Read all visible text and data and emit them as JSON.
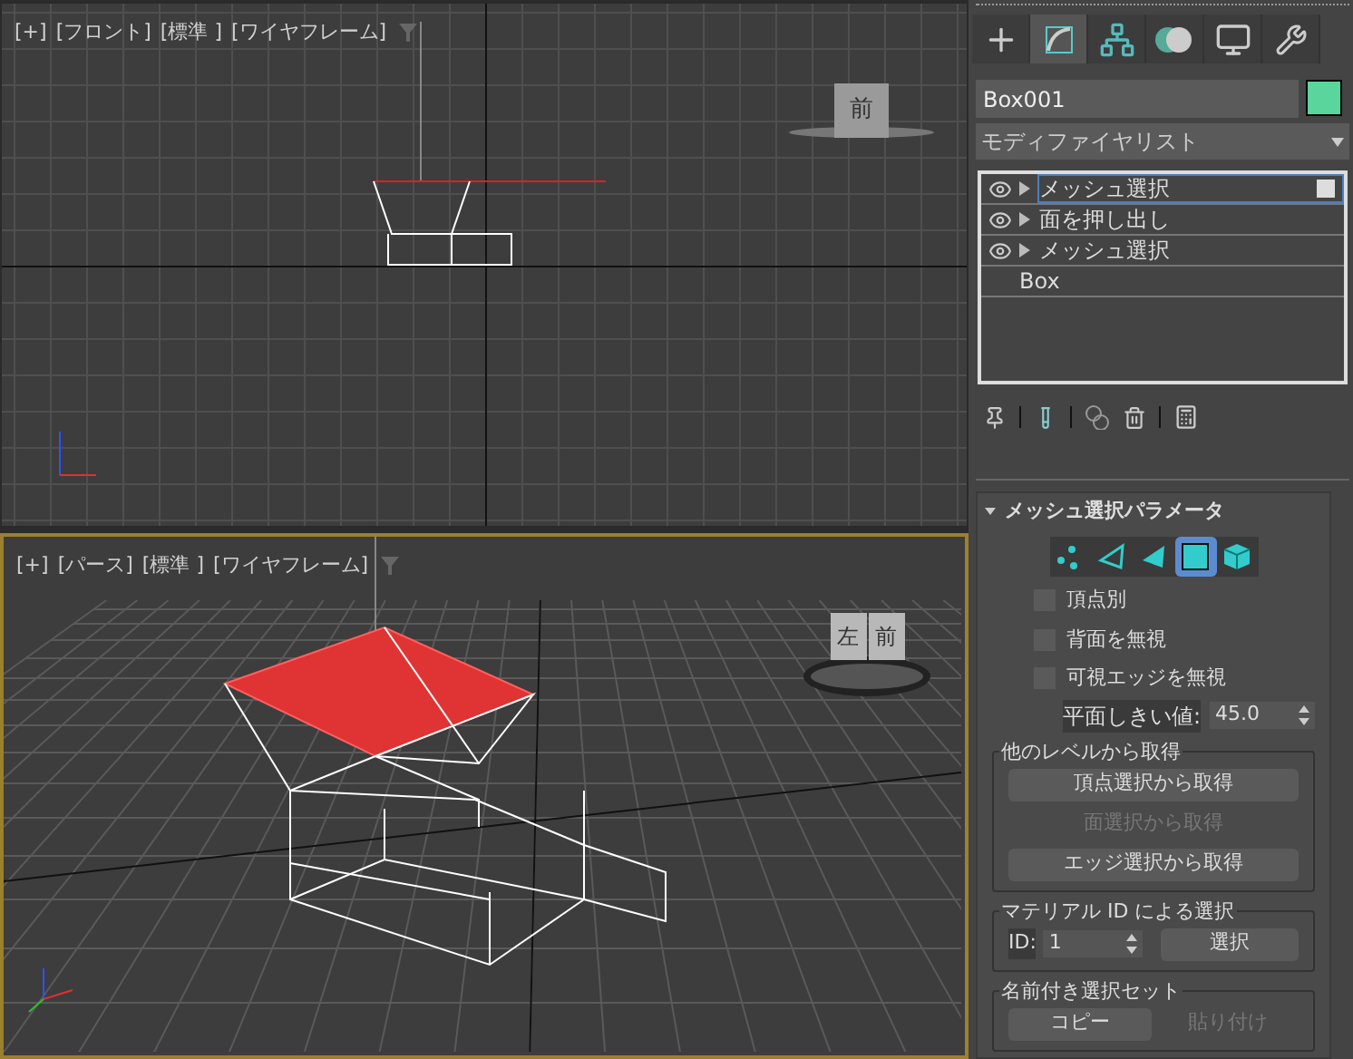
{
  "viewports": [
    {
      "kind": "front",
      "active": false,
      "labels": [
        "[+]",
        "[フロント]",
        "[標準 ]",
        "[ワイヤフレーム]"
      ],
      "view_cube_labels": [
        "前"
      ]
    },
    {
      "kind": "perspective",
      "active": true,
      "labels": [
        "[+]",
        "[パース]",
        "[標準 ]",
        "[ワイヤフレーム]"
      ],
      "view_cube_labels": [
        "左",
        "前"
      ]
    }
  ],
  "command_panel": {
    "tabs": [
      {
        "kind": "create",
        "selected": false
      },
      {
        "kind": "modify",
        "selected": true
      },
      {
        "kind": "hierarchy",
        "selected": false
      },
      {
        "kind": "motion",
        "selected": false
      },
      {
        "kind": "display",
        "selected": false
      },
      {
        "kind": "utilities",
        "selected": false
      }
    ],
    "object": {
      "name": "Box001",
      "color": "#5ad69c"
    },
    "modifier_list": "モディファイヤリスト",
    "stack": [
      {
        "kind": "modifier",
        "label": "メッシュ選択",
        "selected": true,
        "visible": true
      },
      {
        "kind": "modifier",
        "label": "面を押し出し",
        "selected": false,
        "visible": true
      },
      {
        "kind": "modifier",
        "label": "メッシュ選択",
        "selected": false,
        "visible": true
      },
      {
        "kind": "base",
        "label": "Box",
        "selected": false
      }
    ]
  },
  "rollout": {
    "title": "メッシュ選択パラメータ",
    "expanded": true,
    "levels": [
      {
        "kind": "vertex",
        "selected": false
      },
      {
        "kind": "edge",
        "selected": false
      },
      {
        "kind": "face",
        "selected": false
      },
      {
        "kind": "polygon",
        "selected": true
      },
      {
        "kind": "element",
        "selected": false
      }
    ],
    "checkboxes": [
      {
        "label": "頂点別",
        "checked": false
      },
      {
        "label": "背面を無視",
        "checked": false
      },
      {
        "label": "可視エッジを無視",
        "checked": false
      }
    ],
    "threshold": {
      "label": "平面しきい値:",
      "value": "45.0"
    },
    "groups": [
      {
        "title": "他のレベルから取得",
        "kind": "buttons",
        "buttons": [
          {
            "label": "頂点選択から取得",
            "disabled": false
          },
          {
            "label": "面選択から取得",
            "disabled": true
          },
          {
            "label": "エッジ選択から取得",
            "disabled": false
          }
        ]
      },
      {
        "title": "マテリアル ID による選択",
        "kind": "id",
        "id_label": "ID:",
        "id_value": "1",
        "buttons": [
          {
            "label": "選択",
            "disabled": false
          }
        ]
      },
      {
        "title": "名前付き選択セット",
        "kind": "pair",
        "buttons": [
          {
            "label": "コピー",
            "disabled": false
          },
          {
            "label": "貼り付け",
            "disabled": true
          }
        ]
      }
    ]
  }
}
